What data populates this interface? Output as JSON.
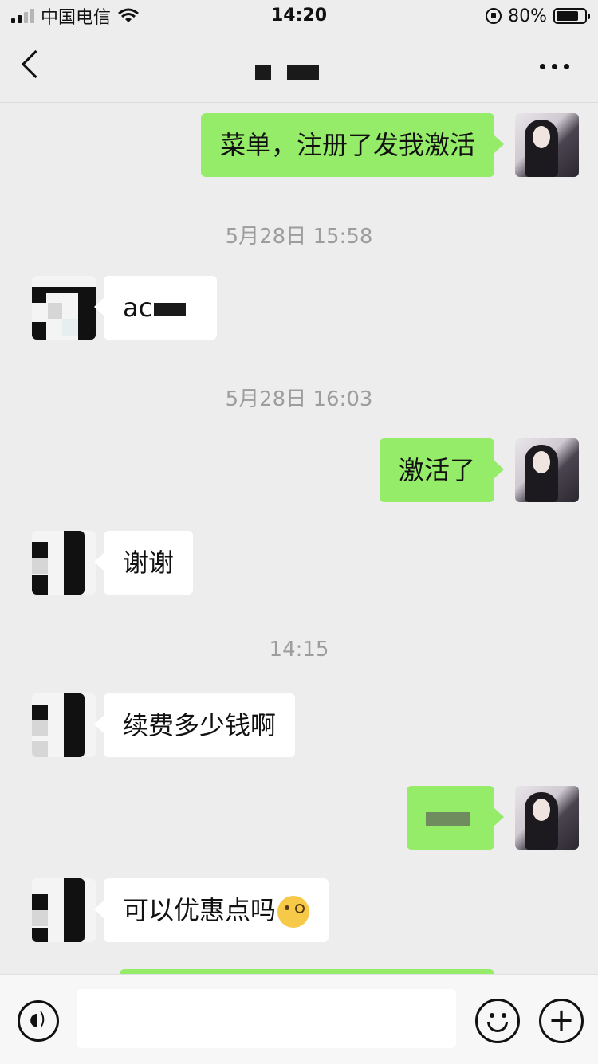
{
  "status_bar": {
    "carrier": "中国电信",
    "time": "14:20",
    "battery": "80%",
    "battery_level": 0.8
  },
  "nav": {
    "title": "",
    "back_icon": "chevron-left-icon",
    "more_icon": "more-dots-icon"
  },
  "messages": [
    {
      "side": "out",
      "text": "菜单，注册了发我激活"
    },
    {
      "type": "time",
      "text": "5月28日 15:58"
    },
    {
      "side": "in",
      "text": "ac"
    },
    {
      "type": "time",
      "text": "5月28日 16:03"
    },
    {
      "side": "out",
      "text": "激活了"
    },
    {
      "side": "in",
      "text": "谢谢"
    },
    {
      "type": "time",
      "text": "14:15"
    },
    {
      "side": "in",
      "text": "续费多少钱啊"
    },
    {
      "side": "out",
      "text": ""
    },
    {
      "side": "in",
      "text": "可以优惠点吗",
      "emoji": "wink-emoji"
    }
  ],
  "input_bar": {
    "placeholder": "",
    "voice_icon": "voice-icon",
    "emoji_icon": "smiley-icon",
    "plus_icon": "plus-icon"
  },
  "colors": {
    "background": "#ededed",
    "outgoing_bubble": "#95ec69",
    "incoming_bubble": "#ffffff",
    "timestamp": "#9d9d9d"
  }
}
